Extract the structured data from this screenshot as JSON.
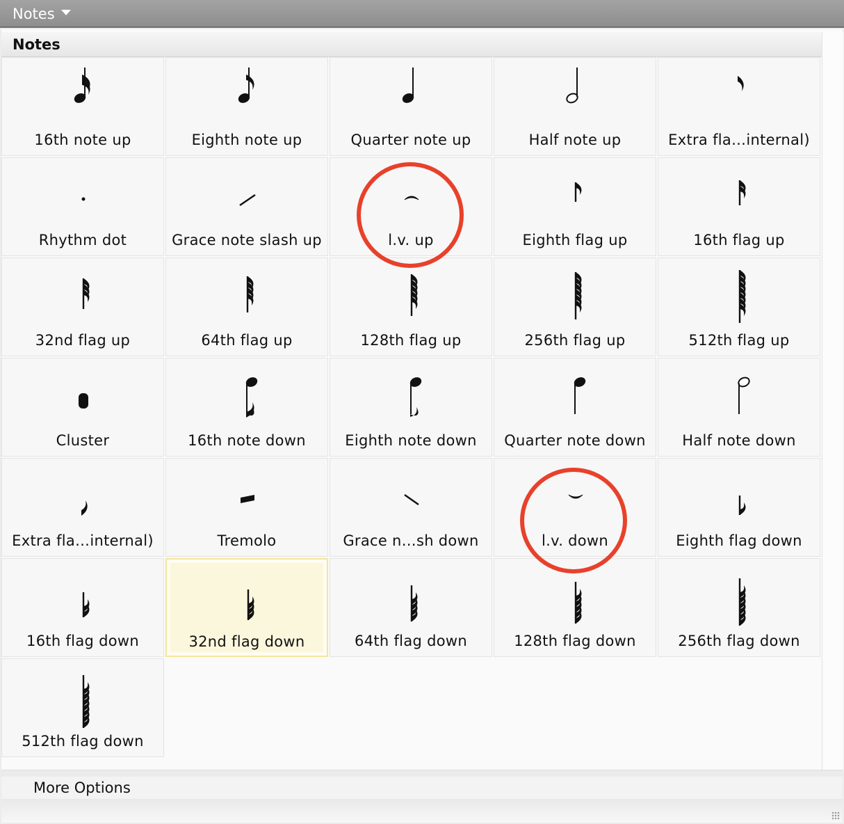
{
  "window": {
    "title": "Notes"
  },
  "section": {
    "title": "Notes"
  },
  "cells": [
    {
      "label": "16th note up",
      "glyph": "note-16th-up"
    },
    {
      "label": "Eighth  note up",
      "glyph": "note-eighth-up"
    },
    {
      "label": "Quarter note up",
      "glyph": "note-quarter-up"
    },
    {
      "label": "Half note up",
      "glyph": "note-half-up"
    },
    {
      "label": "Extra fla…internal)",
      "glyph": "extra-flag-up"
    },
    {
      "label": "Rhythm dot",
      "glyph": "rhythm-dot"
    },
    {
      "label": "Grace note slash up",
      "glyph": "grace-slash-up"
    },
    {
      "label": "l.v. up",
      "glyph": "lv-up"
    },
    {
      "label": "Eighth flag up",
      "glyph": "flag-eighth-up"
    },
    {
      "label": "16th flag up",
      "glyph": "flag-16th-up"
    },
    {
      "label": "32nd flag up",
      "glyph": "flag-32nd-up"
    },
    {
      "label": "64th flag up",
      "glyph": "flag-64th-up"
    },
    {
      "label": "128th flag up",
      "glyph": "flag-128th-up"
    },
    {
      "label": "256th flag up",
      "glyph": "flag-256th-up"
    },
    {
      "label": "512th flag up",
      "glyph": "flag-512th-up"
    },
    {
      "label": "Cluster",
      "glyph": "cluster"
    },
    {
      "label": "16th note down",
      "glyph": "note-16th-down"
    },
    {
      "label": "Eighth note down",
      "glyph": "note-eighth-down"
    },
    {
      "label": "Quarter note down",
      "glyph": "note-quarter-down"
    },
    {
      "label": "Half note down",
      "glyph": "note-half-down"
    },
    {
      "label": "Extra fla…internal)",
      "glyph": "extra-flag-down"
    },
    {
      "label": "Tremolo",
      "glyph": "tremolo"
    },
    {
      "label": "Grace n…sh down",
      "glyph": "grace-slash-down"
    },
    {
      "label": "l.v. down",
      "glyph": "lv-down"
    },
    {
      "label": "Eighth flag down",
      "glyph": "flag-eighth-down"
    },
    {
      "label": "16th flag down",
      "glyph": "flag-16th-down"
    },
    {
      "label": "32nd flag down",
      "glyph": "flag-32nd-down",
      "selected": true
    },
    {
      "label": "64th flag down",
      "glyph": "flag-64th-down"
    },
    {
      "label": "128th flag down",
      "glyph": "flag-128th-down"
    },
    {
      "label": "256th flag down",
      "glyph": "flag-256th-down"
    },
    {
      "label": "512th flag down",
      "glyph": "flag-512th-down"
    }
  ],
  "more_options": {
    "label": "More Options"
  },
  "highlights": [
    "l.v. up",
    "l.v. down"
  ],
  "colors": {
    "highlight": "#e8412b",
    "selected_bg": "#fbf7dc"
  }
}
